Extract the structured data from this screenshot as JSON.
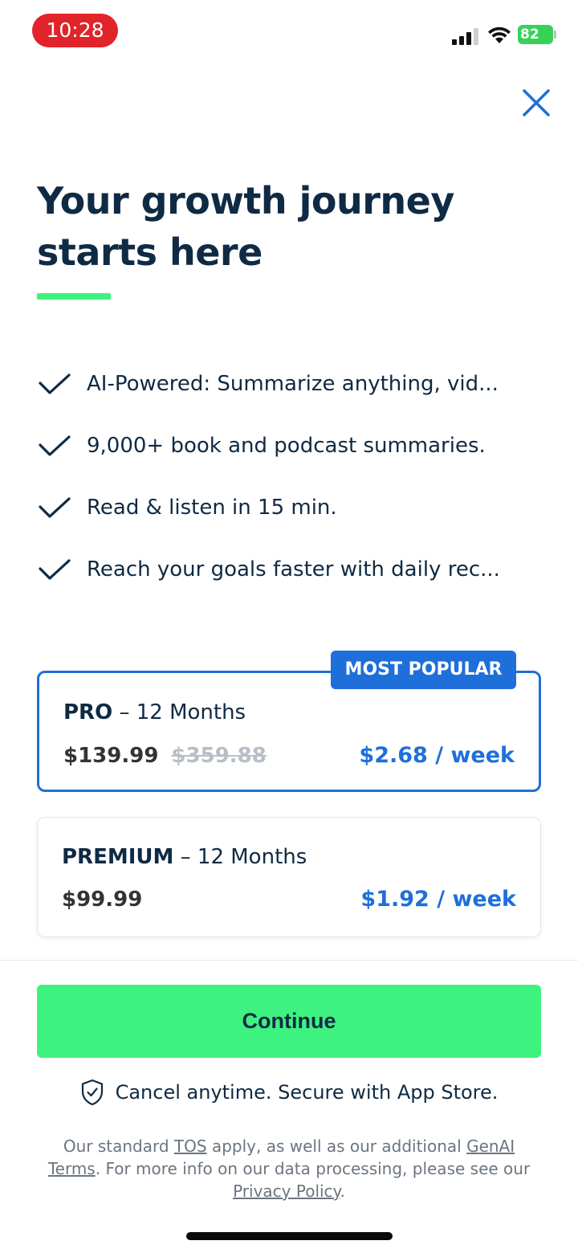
{
  "status_bar": {
    "time": "10:28",
    "battery": "82"
  },
  "headline": {
    "line1": "Your growth journey",
    "line2": "starts here",
    "accent_color": "#3ef27f"
  },
  "features": [
    {
      "text": "AI-Powered: Summarize anything, vid...",
      "icon": "check-icon"
    },
    {
      "text": "9,000+ book and podcast summaries.",
      "icon": "check-icon"
    },
    {
      "text": "Read & listen in 15 min.",
      "icon": "check-icon"
    },
    {
      "text": "Reach your goals faster with daily rec...",
      "icon": "check-icon"
    }
  ],
  "plans": {
    "pro": {
      "badge": "MOST POPULAR",
      "name": "PRO",
      "duration": " – 12 Months",
      "price": "$139.99",
      "old_price": "$359.88",
      "weekly": "$2.68 / week",
      "selected": true
    },
    "premium": {
      "name": "PREMIUM",
      "duration": " – 12 Months",
      "price": "$99.99",
      "weekly": "$1.92 / week",
      "selected": false
    }
  },
  "continue_label": "Continue",
  "secure_text": "Cancel anytime. Secure with App Store.",
  "legal": {
    "part1": "Our standard ",
    "tos": "TOS",
    "part2": " apply, as well as our additional ",
    "genai": "GenAI Terms",
    "part3": ". For more info on our data processing, please see our ",
    "privacy": "Privacy Policy",
    "part4": "."
  },
  "colors": {
    "primary_blue": "#1e6fd9",
    "accent_green": "#3ef27f",
    "text_dark": "#0f2a44",
    "time_pill": "#e0242a"
  }
}
